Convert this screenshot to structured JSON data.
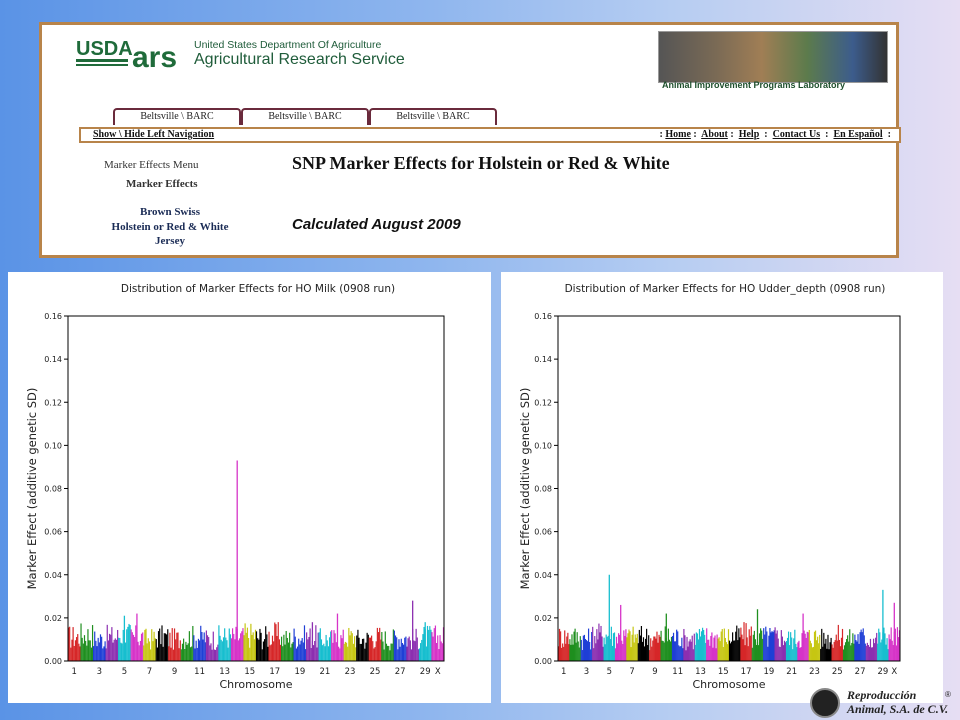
{
  "header": {
    "usda_text": "USDA",
    "ars_text": "ars",
    "agency_line1": "United States Department Of Agriculture",
    "agency_line2": "Agricultural Research Service",
    "lab_name": "Animal Improvement Programs Laboratory"
  },
  "tabs": [
    "Beltsville \\ BARC",
    "Beltsville \\ BARC",
    "Beltsville \\ BARC"
  ],
  "navbar": {
    "toggle": "Show \\ Hide Left Navigation",
    "links": [
      "Home",
      "About",
      "Help",
      "Contact Us",
      "En Español"
    ]
  },
  "left_menu": {
    "title": "Marker Effects Menu",
    "section": "Marker Effects",
    "breeds": [
      "Brown Swiss",
      "Holstein or Red & White",
      "Jersey"
    ]
  },
  "main": {
    "title": "SNP Marker Effects for Holstein or Red & White",
    "subtitle": "Calculated August 2009"
  },
  "footer_logo": {
    "line1": "Reproducción",
    "line2": "Animal, S.A. de C.V.",
    "reg": "®"
  },
  "colors": {
    "frame_border": "#b8844a",
    "tab_border": "#6a2a3c",
    "chromosome_palette": [
      "#d62728",
      "#1f8f1f",
      "#1f3fd6",
      "#8c2fb0",
      "#17becf",
      "#d633c8",
      "#c6c613",
      "#000000"
    ]
  },
  "chart_data": [
    {
      "type": "manhattan",
      "title": "Distribution of Marker Effects for HO Milk (0908 run)",
      "xlabel": "Chromosome",
      "ylabel": "Marker Effect (additive genetic SD)",
      "ylim": [
        0,
        0.16
      ],
      "yticks": [
        "0.00",
        "0.02",
        "0.04",
        "0.06",
        "0.08",
        "0.10",
        "0.12",
        "0.14",
        "0.16"
      ],
      "xticks": [
        "1",
        "3",
        "5",
        "7",
        "9",
        "11",
        "13",
        "15",
        "17",
        "19",
        "21",
        "23",
        "25",
        "27",
        "29",
        "X"
      ],
      "chromosomes": [
        "1",
        "2",
        "3",
        "4",
        "5",
        "6",
        "7",
        "8",
        "9",
        "10",
        "11",
        "12",
        "13",
        "14",
        "15",
        "16",
        "17",
        "18",
        "19",
        "20",
        "21",
        "22",
        "23",
        "24",
        "25",
        "26",
        "27",
        "28",
        "29",
        "X"
      ],
      "baseline_by_chromosome": [
        0.012,
        0.013,
        0.011,
        0.012,
        0.013,
        0.012,
        0.011,
        0.012,
        0.011,
        0.012,
        0.012,
        0.011,
        0.012,
        0.012,
        0.013,
        0.012,
        0.013,
        0.011,
        0.012,
        0.012,
        0.011,
        0.011,
        0.012,
        0.011,
        0.012,
        0.011,
        0.012,
        0.011,
        0.012,
        0.012
      ],
      "peaks": [
        {
          "chromosome": "5",
          "value": 0.021
        },
        {
          "chromosome": "6",
          "value": 0.022
        },
        {
          "chromosome": "14",
          "value": 0.093
        },
        {
          "chromosome": "20",
          "value": 0.018
        },
        {
          "chromosome": "22",
          "value": 0.022
        },
        {
          "chromosome": "28",
          "value": 0.028
        },
        {
          "chromosome": "29",
          "value": 0.018
        }
      ]
    },
    {
      "type": "manhattan",
      "title": "Distribution of Marker Effects for HO Udder_depth (0908 run)",
      "xlabel": "Chromosome",
      "ylabel": "Marker Effect (additive genetic SD)",
      "ylim": [
        0,
        0.16
      ],
      "yticks": [
        "0.00",
        "0.02",
        "0.04",
        "0.06",
        "0.08",
        "0.10",
        "0.12",
        "0.14",
        "0.16"
      ],
      "xticks": [
        "1",
        "3",
        "5",
        "7",
        "9",
        "11",
        "13",
        "15",
        "17",
        "19",
        "21",
        "23",
        "25",
        "27",
        "29",
        "X"
      ],
      "chromosomes": [
        "1",
        "2",
        "3",
        "4",
        "5",
        "6",
        "7",
        "8",
        "9",
        "10",
        "11",
        "12",
        "13",
        "14",
        "15",
        "16",
        "17",
        "18",
        "19",
        "20",
        "21",
        "22",
        "23",
        "24",
        "25",
        "26",
        "27",
        "28",
        "29",
        "X"
      ],
      "baseline_by_chromosome": [
        0.012,
        0.012,
        0.011,
        0.013,
        0.013,
        0.012,
        0.012,
        0.012,
        0.011,
        0.012,
        0.012,
        0.011,
        0.012,
        0.012,
        0.012,
        0.012,
        0.013,
        0.012,
        0.012,
        0.012,
        0.011,
        0.012,
        0.012,
        0.011,
        0.012,
        0.011,
        0.012,
        0.011,
        0.012,
        0.012
      ],
      "peaks": [
        {
          "chromosome": "5",
          "value": 0.04
        },
        {
          "chromosome": "6",
          "value": 0.026
        },
        {
          "chromosome": "10",
          "value": 0.022
        },
        {
          "chromosome": "18",
          "value": 0.024
        },
        {
          "chromosome": "22",
          "value": 0.022
        },
        {
          "chromosome": "29",
          "value": 0.033
        },
        {
          "chromosome": "X",
          "value": 0.027
        }
      ]
    }
  ]
}
